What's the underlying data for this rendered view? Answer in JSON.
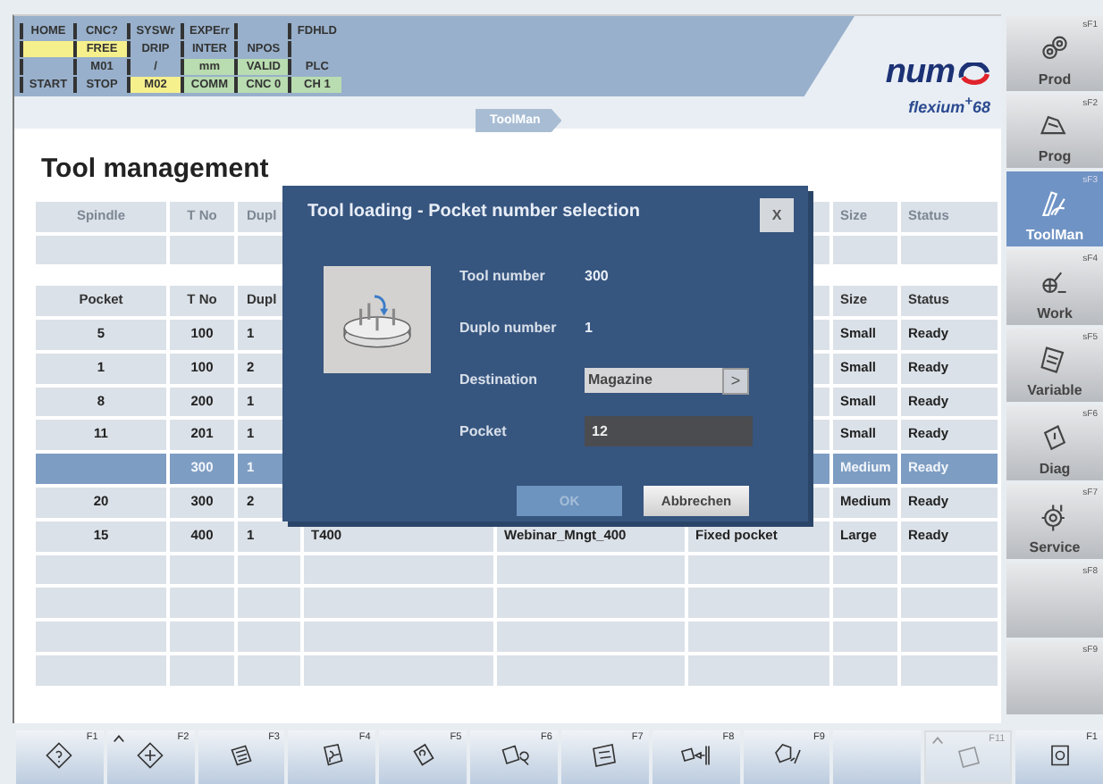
{
  "status_grid": [
    [
      {
        "kind": "text",
        "text": "HOME"
      },
      {
        "kind": "text",
        "text": "CNC?"
      },
      {
        "kind": "text",
        "text": "SYSWr"
      },
      {
        "kind": "text",
        "text": "EXPErr"
      },
      {
        "kind": "blank"
      },
      {
        "kind": "text",
        "text": "FDHLD"
      }
    ],
    [
      {
        "kind": "blank",
        "color": "#f6f08c"
      },
      {
        "kind": "text",
        "text": "FREE",
        "color": "#f6f08c"
      },
      {
        "kind": "text",
        "text": "DRIP"
      },
      {
        "kind": "text",
        "text": "INTER"
      },
      {
        "kind": "text",
        "text": "NPOS"
      },
      {
        "kind": "blank"
      }
    ],
    [
      {
        "kind": "blank"
      },
      {
        "kind": "text",
        "text": "M01"
      },
      {
        "kind": "text",
        "text": "/"
      },
      {
        "kind": "text",
        "text": "mm",
        "color": "#b9dcb0"
      },
      {
        "kind": "text",
        "text": "VALID",
        "color": "#b9dcb0"
      },
      {
        "kind": "text",
        "text": "PLC"
      }
    ],
    [
      {
        "kind": "text",
        "text": "START"
      },
      {
        "kind": "text",
        "text": "STOP"
      },
      {
        "kind": "text",
        "text": "M02",
        "color": "#f6f08c"
      },
      {
        "kind": "text",
        "text": "COMM",
        "color": "#b9dcb0"
      },
      {
        "kind": "text",
        "text": "CNC 0",
        "color": "#b9dcb0"
      },
      {
        "kind": "text",
        "text": "CH 1",
        "color": "#b9dcb0"
      }
    ]
  ],
  "breadcrumb": "ToolMan",
  "logo": {
    "brand": "num",
    "product": "flexium$^{+}$68"
  },
  "page_title": "Tool management",
  "spindle_table": {
    "columns": [
      "Spindle",
      "T No",
      "Dupl",
      null,
      null,
      null,
      "Size",
      "Status"
    ]
  },
  "pocket_table": {
    "columns": [
      "Pocket",
      "T No",
      "Dupl",
      null,
      null,
      null,
      "Size",
      "Status"
    ],
    "rows": [
      {
        "cells": [
          "5",
          "100",
          "1",
          null,
          null,
          null,
          "Small",
          "Ready"
        ],
        "selected": false
      },
      {
        "cells": [
          "1",
          "100",
          "2",
          null,
          null,
          null,
          "Small",
          "Ready"
        ],
        "selected": false
      },
      {
        "cells": [
          "8",
          "200",
          "1",
          null,
          null,
          null,
          "Small",
          "Ready"
        ],
        "selected": false
      },
      {
        "cells": [
          "11",
          "201",
          "1",
          null,
          null,
          null,
          "Small",
          "Ready"
        ],
        "selected": false
      },
      {
        "cells": [
          null,
          "300",
          "1",
          null,
          null,
          null,
          "Medium",
          "Ready"
        ],
        "selected": true
      },
      {
        "cells": [
          "20",
          "300",
          "2",
          null,
          null,
          null,
          "Medium",
          "Ready"
        ],
        "selected": false
      },
      {
        "cells": [
          "15",
          "400",
          "1",
          "T400",
          "Webinar_Mngt_400",
          "Fixed pocket",
          "Large",
          "Ready"
        ],
        "selected": false
      }
    ]
  },
  "dialog": {
    "title": "Tool loading - Pocket number selection",
    "close": "X",
    "fields": [
      {
        "kind": "text",
        "label": "Tool number",
        "value": "300"
      },
      {
        "kind": "text",
        "label": "Duplo number",
        "value": "1"
      },
      {
        "kind": "dropdown",
        "label": "Destination",
        "value": "Magazine",
        "button": ">"
      },
      {
        "kind": "input",
        "label": "Pocket",
        "value": "12"
      }
    ],
    "buttons": [
      {
        "label": "OK",
        "disabled": true
      },
      {
        "label": "Abbrechen",
        "disabled": false
      }
    ]
  },
  "softkeys": [
    {
      "key": "sF1",
      "label": "Prod",
      "selected": false
    },
    {
      "key": "sF2",
      "label": "Prog",
      "selected": false
    },
    {
      "key": "sF3",
      "label": "ToolMan",
      "selected": true
    },
    {
      "key": "sF4",
      "label": "Work",
      "selected": false
    },
    {
      "key": "sF5",
      "label": "Variable",
      "selected": false
    },
    {
      "key": "sF6",
      "label": "Diag",
      "selected": false
    },
    {
      "key": "sF7",
      "label": "Service",
      "selected": false
    },
    {
      "key": "sF8",
      "selected": false
    },
    {
      "key": "sF9",
      "selected": false
    }
  ],
  "function_keys": [
    {
      "key": "F1",
      "shift": false,
      "disabled": false
    },
    {
      "key": "F2",
      "shift": true,
      "disabled": false
    },
    {
      "key": "F3",
      "shift": false,
      "disabled": false
    },
    {
      "key": "F4",
      "shift": false,
      "disabled": false
    },
    {
      "key": "F5",
      "shift": false,
      "disabled": false
    },
    {
      "key": "F6",
      "shift": false,
      "disabled": false
    },
    {
      "key": "F7",
      "shift": false,
      "disabled": false
    },
    {
      "key": "F8",
      "shift": false,
      "disabled": false
    },
    {
      "key": "F9",
      "shift": false,
      "disabled": false
    },
    {
      "shift": false,
      "disabled": false
    },
    {
      "key": "F11",
      "shift": true,
      "disabled": true
    },
    {
      "key": "F1",
      "shift": false,
      "disabled": false
    }
  ]
}
